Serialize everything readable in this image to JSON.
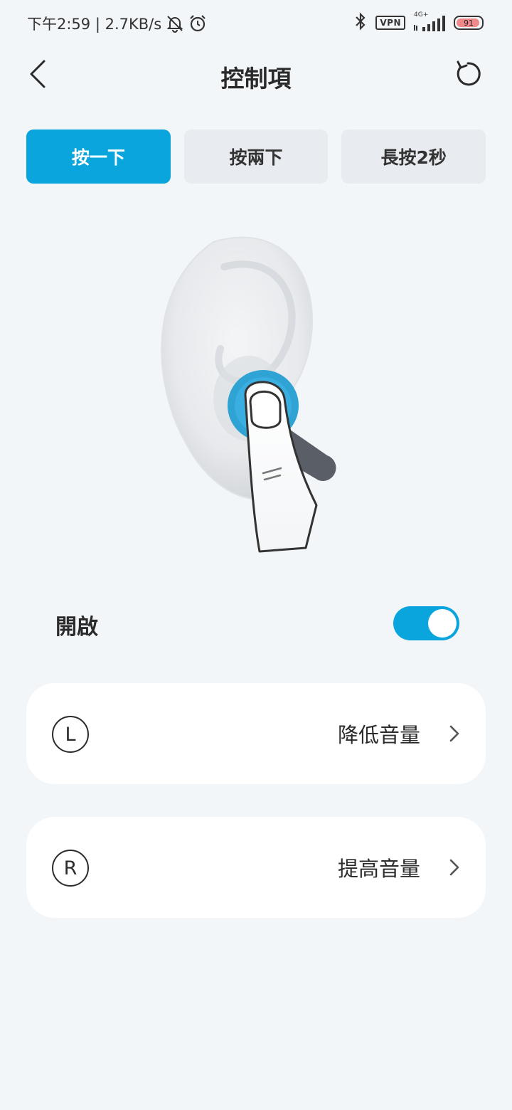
{
  "status_bar": {
    "time_speed": "下午2:59 | 2.7KB/s",
    "vpn": "VPN",
    "network_type": "4G+",
    "battery": "91"
  },
  "header": {
    "title": "控制項"
  },
  "tabs": [
    {
      "label": "按一下",
      "active": true
    },
    {
      "label": "按兩下",
      "active": false
    },
    {
      "label": "長按2秒",
      "active": false
    }
  ],
  "toggle": {
    "label": "開啟",
    "on": true
  },
  "actions": [
    {
      "side": "L",
      "value": "降低音量"
    },
    {
      "side": "R",
      "value": "提高音量"
    }
  ],
  "colors": {
    "accent": "#0aa5dd",
    "background": "#f3f6f9"
  }
}
